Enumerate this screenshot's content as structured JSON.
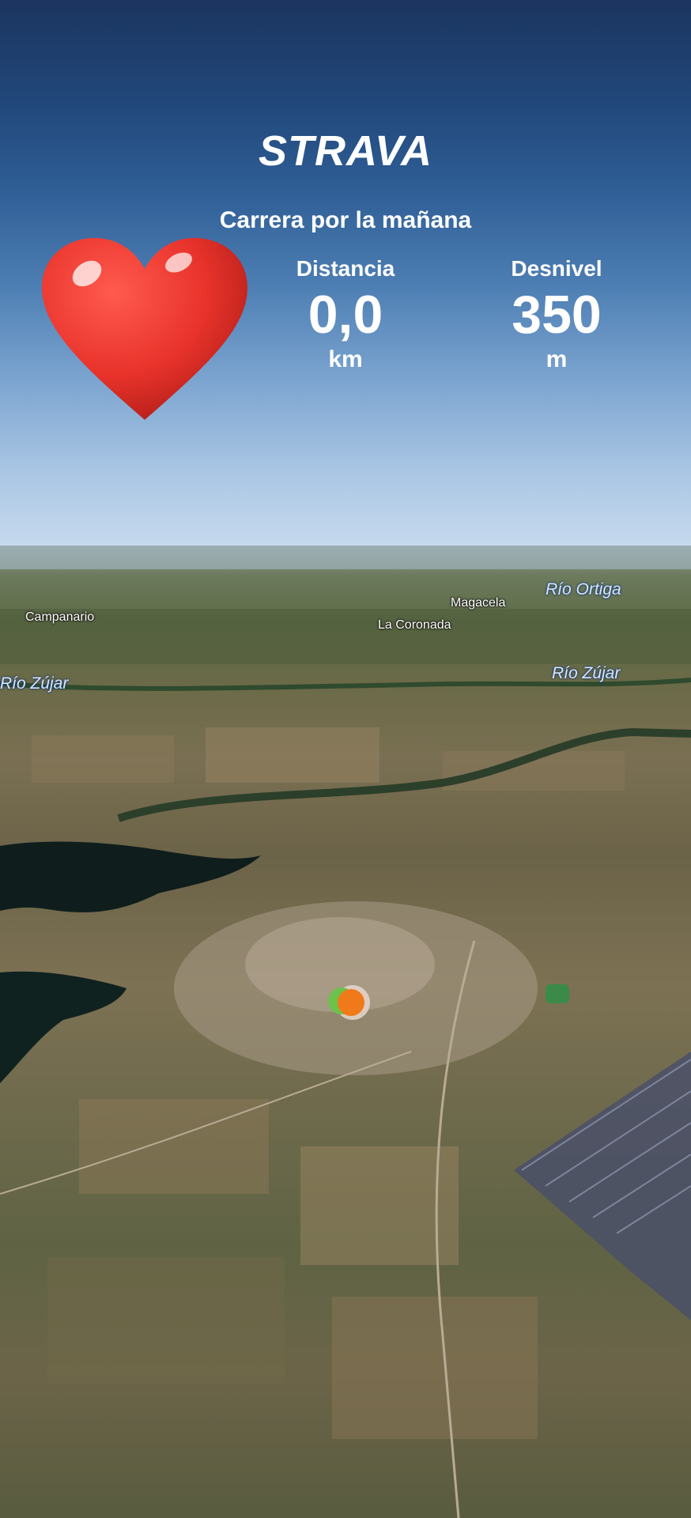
{
  "app": {
    "brand": "STRAVA"
  },
  "activity": {
    "title": "Carrera por la mañana"
  },
  "stats": {
    "distance": {
      "label": "Distancia",
      "value": "0,0",
      "unit": "km"
    },
    "elevation": {
      "label": "Desnivel",
      "value": "350",
      "unit": "m"
    }
  },
  "map": {
    "places": {
      "campanario": "Campanario",
      "magacela": "Magacela",
      "la_coronada": "La Coronada"
    },
    "rivers": {
      "ortiga": "Río Ortiga",
      "zujar_right": "Río Zújar",
      "zujar_left": "Río Zújar"
    }
  },
  "icons": {
    "heart": "heart-icon",
    "marker": "position-marker-icon"
  },
  "colors": {
    "heart": "#e8332b",
    "marker_orange": "#f07a1a",
    "marker_green": "#6cc24a"
  }
}
